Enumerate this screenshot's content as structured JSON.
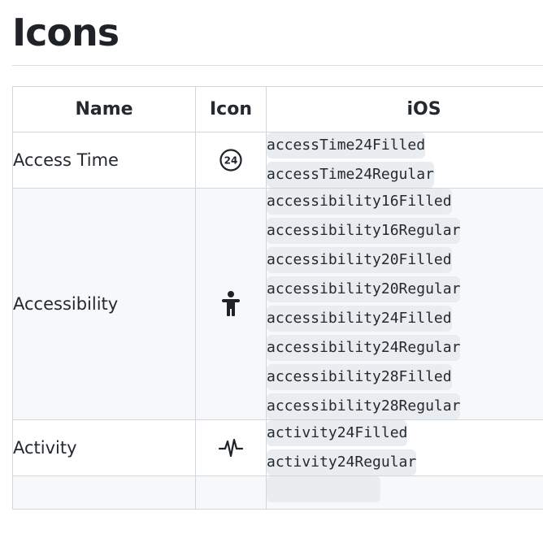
{
  "page": {
    "title": "Icons"
  },
  "table": {
    "headers": {
      "name": "Name",
      "icon": "Icon",
      "ios": "iOS"
    },
    "rows": [
      {
        "name": "Access Time",
        "icon": "access-time-24-icon",
        "ios": [
          "accessTime24Filled",
          "accessTime24Regular"
        ]
      },
      {
        "name": "Accessibility",
        "icon": "accessibility-person-icon",
        "ios": [
          "accessibility16Filled",
          "accessibility16Regular",
          "accessibility20Filled",
          "accessibility20Regular",
          "accessibility24Filled",
          "accessibility24Regular",
          "accessibility28Filled",
          "accessibility28Regular"
        ]
      },
      {
        "name": "Activity",
        "icon": "activity-pulse-icon",
        "ios": [
          "activity24Filled",
          "activity24Regular"
        ]
      }
    ]
  },
  "icon_glyphs": {
    "access_time_number": "24"
  },
  "colors": {
    "row_alt_background": "#f6f8fa",
    "code_background": "#eaedf0",
    "border": "#d0d7de"
  }
}
